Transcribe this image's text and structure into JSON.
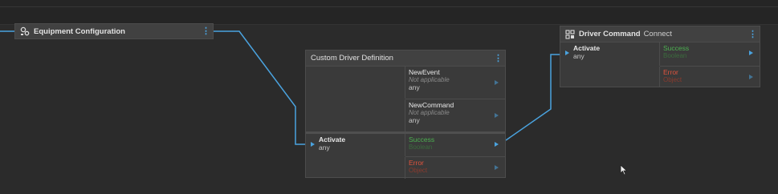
{
  "equipment_node": {
    "title": "Equipment Configuration"
  },
  "custom_node": {
    "title": "Custom Driver Definition",
    "events": [
      {
        "name": "NewEvent",
        "status": "Not applicable",
        "type": "any"
      },
      {
        "name": "NewCommand",
        "status": "Not applicable",
        "type": "any"
      }
    ],
    "input": {
      "label": "Activate",
      "type": "any"
    },
    "outputs": [
      {
        "label": "Success",
        "type": "Boolean"
      },
      {
        "label": "Error",
        "type": "Object"
      }
    ]
  },
  "driver_node": {
    "title": "Driver Command",
    "subtitle": "Connect",
    "input": {
      "label": "Activate",
      "type": "any"
    },
    "outputs": [
      {
        "label": "Success",
        "type": "Boolean"
      },
      {
        "label": "Error",
        "type": "Object"
      }
    ]
  },
  "colors": {
    "wire": "#4aa3df",
    "success": "#4caf50",
    "error": "#e0533d"
  }
}
